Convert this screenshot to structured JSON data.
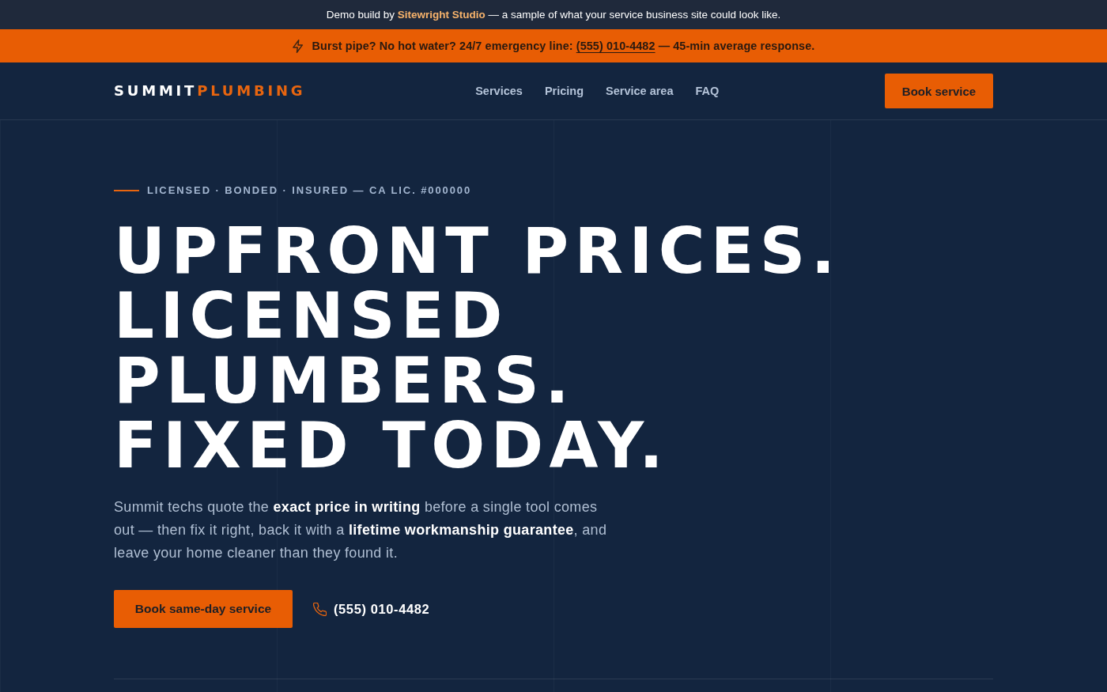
{
  "demo_banner": {
    "before": "Demo build by",
    "link": "Sitewright Studio",
    "after": "— a sample of what your service business site could look like."
  },
  "emergency_bar": {
    "before": "Burst pipe? No hot water? 24/7 emergency line:",
    "phone": "(555) 010-4482",
    "after": "— 45-min average response."
  },
  "header": {
    "logo": {
      "primary": "SUMMIT",
      "accent": "PLUMBING"
    },
    "nav_links": [
      "Services",
      "Pricing",
      "Service area",
      "FAQ"
    ],
    "cta": "Book service"
  },
  "hero": {
    "eyebrow": "LICENSED · BONDED · INSURED — CA LIC. #000000",
    "headline": [
      "UPFRONT PRICES.",
      "LICENSED",
      "PLUMBERS.",
      "FIXED TODAY."
    ],
    "lead": "Summit techs quote the **exact price in writing** before a single tool comes out — then fix it right, back it with a **lifetime workmanship guarantee**, and leave your home cleaner than they found it.",
    "primary_button": "Book same-day service",
    "phone_link": "(555) 010-4482"
  }
}
